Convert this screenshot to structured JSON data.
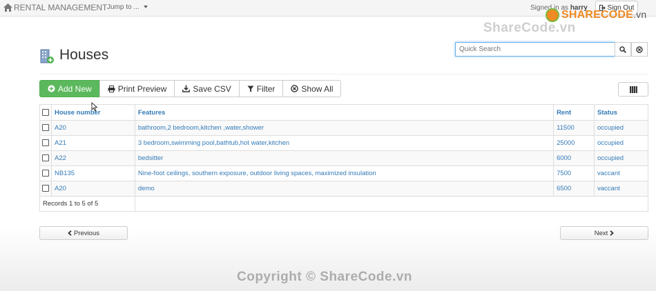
{
  "navbar": {
    "brand": "RENTAL MANAGEMENT",
    "jump_label": "Jump to ...",
    "signed_in_prefix": "Signed in as",
    "username": "harry",
    "signout_label": "Sign Out"
  },
  "watermark": {
    "logo_main": "SHARECODE",
    "logo_suffix": ".vn",
    "top_text": "ShareCode.vn",
    "bottom_text": "Copyright © ShareCode.vn"
  },
  "page": {
    "title": "Houses",
    "icon": "building-add-icon"
  },
  "search": {
    "placeholder": "Quick Search",
    "search_icon": "search-icon",
    "clear_icon": "clear-circle-icon"
  },
  "toolbar": {
    "add_new": "Add New",
    "print_preview": "Print Preview",
    "save_csv": "Save CSV",
    "filter": "Filter",
    "show_all": "Show All",
    "columns_icon": "columns-icon"
  },
  "table": {
    "columns": [
      "House number",
      "Features",
      "Rent",
      "Status"
    ],
    "rows": [
      {
        "house_number": "A20",
        "features": "bathroom,2 bedroom,kitchen ,water,shower",
        "rent": "11500",
        "status": "occupied"
      },
      {
        "house_number": "A21",
        "features": "3 bedroom,swimming pool,bathtub,hot water,kitchen",
        "rent": "25000",
        "status": "occupied"
      },
      {
        "house_number": "A22",
        "features": "bedsitter",
        "rent": "6000",
        "status": "occupied"
      },
      {
        "house_number": "NB135",
        "features": "Nine-foot ceilings, southern exposure, outdoor living spaces, maximized insulation",
        "rent": "7500",
        "status": "vaccant"
      },
      {
        "house_number": "A20",
        "features": "demo",
        "rent": "6500",
        "status": "vaccant"
      }
    ],
    "records_text": "Records 1 to 5 of 5"
  },
  "pager": {
    "previous": "Previous",
    "next": "Next"
  },
  "colors": {
    "link": "#337ab7",
    "success": "#5cb85c",
    "focus": "#66afe9"
  }
}
